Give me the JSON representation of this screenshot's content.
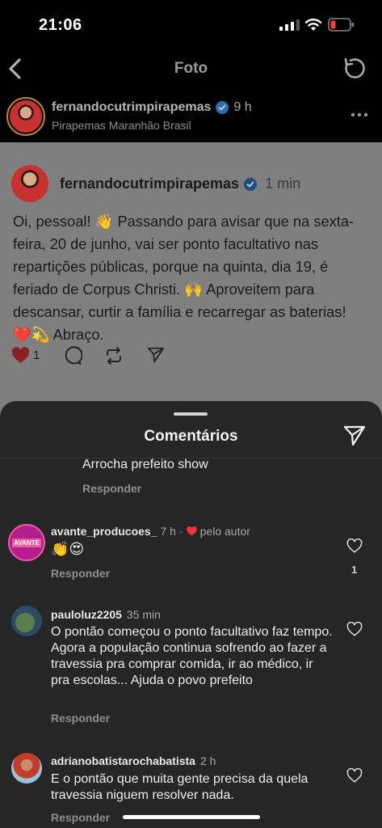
{
  "status_bar": {
    "time": "21:06"
  },
  "nav": {
    "title": "Foto"
  },
  "post_header": {
    "username": "fernandocutrimpirapemas",
    "time": "9 h",
    "location": "Pirapemas Maranhão Brasil"
  },
  "thread": {
    "username": "fernandocutrimpirapemas",
    "time": "1 min",
    "text": "Oi, pessoal! 👋 Passando para avisar que na sexta-feira, 20 de junho, vai ser ponto facultativo nas repartições públicas, porque na quinta, dia 19, é feriado de Corpus Christi. 🙌 Aproveitem para descansar, curtir a família e recarregar as baterias! ❤️💫 Abraço.",
    "like_count": "1"
  },
  "comments_sheet": {
    "title": "Comentários",
    "reply_label": "Responder",
    "partial_comment": {
      "text": "Arrocha prefeito show"
    },
    "comments": [
      {
        "username": "avante_producoes_",
        "time": "7 h",
        "author_like": "pelo autor",
        "avatar_text": "AVANTE",
        "text": "👏😍",
        "likes": "1"
      },
      {
        "username": "pauloluz2205",
        "time": "35 min",
        "text": "O pontão começou o ponto facultativo faz tempo.  Agora a população continua sofrendo ao  fazer a travessia  pra comprar comida, ir ao médico, ir pra escolas... Ajuda o povo prefeito"
      },
      {
        "username": "adrianobatistarochabatista",
        "time": "2 h",
        "text": "E o pontão que muita gente precisa da quela travessia niguem resolver nada."
      }
    ]
  },
  "colors": {
    "sheet_bg": "#262626",
    "thread_bg": "#7f7f7f",
    "verified": "#3797f0",
    "like_red": "#ff3040"
  },
  "icons": [
    "back-icon",
    "refresh-icon",
    "verified-icon",
    "more-icon",
    "heart-icon",
    "comment-icon",
    "repost-icon",
    "send-icon",
    "share-icon"
  ]
}
